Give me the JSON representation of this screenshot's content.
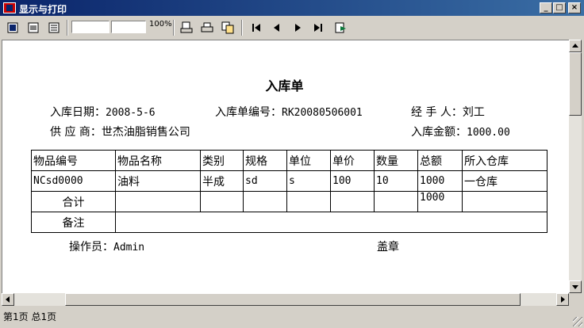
{
  "window": {
    "title": "显示与打印"
  },
  "toolbar": {
    "zoom_label": "100%"
  },
  "document": {
    "title": "入库单",
    "fields": {
      "date_label": "入库日期：",
      "date_value": "2008-5-6",
      "number_label": "入库单编号：",
      "number_value": "RK20080506001",
      "handler_label": "经 手 人：",
      "handler_value": "刘工",
      "supplier_label": "供 应 商：",
      "supplier_value": "世杰油脂销售公司",
      "amount_label": "入库金额：",
      "amount_value": "1000.00"
    },
    "table": {
      "headers": [
        "物品编号",
        "物品名称",
        "类别",
        "规格",
        "单位",
        "单价",
        "数量",
        "总额",
        "所入仓库"
      ],
      "rows": [
        [
          "NCsd0000",
          "油料",
          "半成",
          "sd",
          "s",
          "100",
          "10",
          "1000",
          "一仓库"
        ]
      ],
      "total_label": "合计",
      "total_value": "1000",
      "remark_label": "备注"
    },
    "operator_label": "操作员：",
    "operator_value": "Admin",
    "seal_label": "盖章"
  },
  "status": {
    "text": "第1页 总1页"
  }
}
